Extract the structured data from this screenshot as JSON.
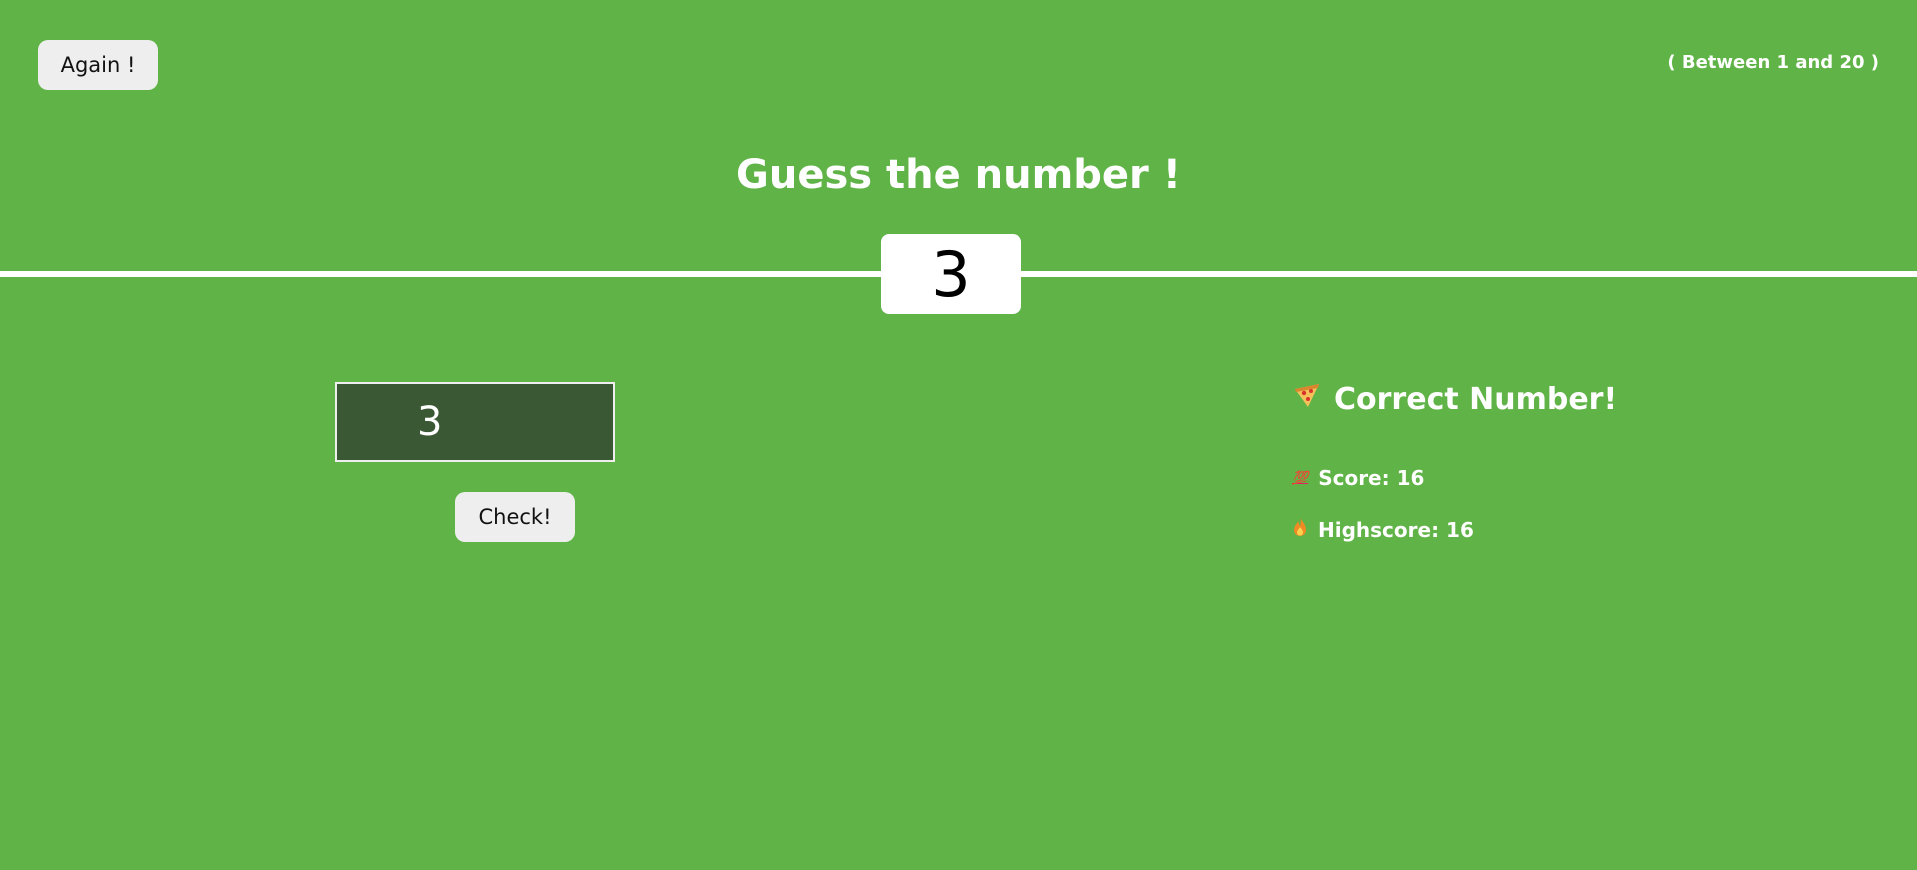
{
  "header": {
    "again_label": "Again !",
    "range_text": "( Between 1 and 20 )"
  },
  "title": "Guess the number !",
  "secret_number": "3",
  "guess_input": {
    "value": "3"
  },
  "check_label": "Check!",
  "message": {
    "icon": "pizza-icon",
    "text": "Correct Number!"
  },
  "stats": {
    "score_label": "Score: 16",
    "highscore_label": "Highscore: 16"
  },
  "colors": {
    "background": "#60b347",
    "input_background": "#3a5833",
    "text": "#ffffff"
  }
}
